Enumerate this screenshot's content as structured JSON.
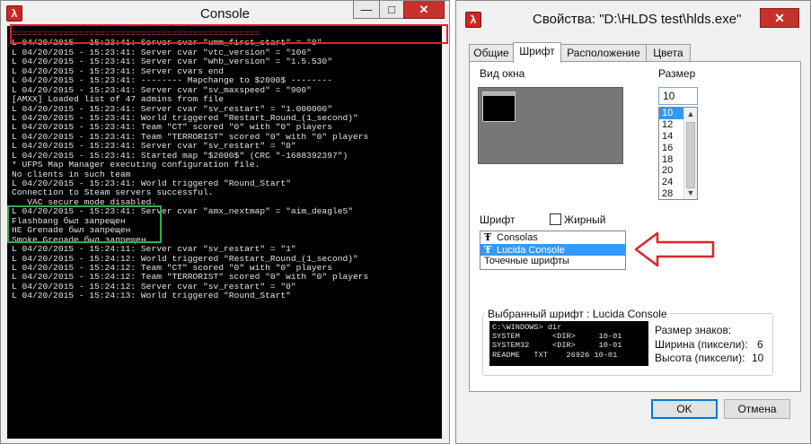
{
  "console": {
    "title": "Console",
    "minimize_glyph": "—",
    "maximize_glyph": "□",
    "close_glyph": "✕",
    "app_icon_glyph": "λ",
    "lines": [
      "================================================",
      "L 04/20/2015 - 15:23:41: Server cvar \"umm_first_start\" = \"0\"",
      "L 04/20/2015 - 15:23:41: Server cvar \"vtc_version\" = \"106\"",
      "L 04/20/2015 - 15:23:41: Server cvar \"whb_version\" = \"1.5.530\"",
      "L 04/20/2015 - 15:23:41: Server cvars end",
      "L 04/20/2015 - 15:23:41: -------- Mapchange to $2000$ --------",
      "L 04/20/2015 - 15:23:41: Server cvar \"sv_maxspeed\" = \"900\"",
      "[AMXX] Loaded list of 47 admins from file",
      "L 04/20/2015 - 15:23:41: Server cvar \"sv_restart\" = \"1.000000\"",
      "L 04/20/2015 - 15:23:41: World triggered \"Restart_Round_(1_second)\"",
      "L 04/20/2015 - 15:23:41: Team \"CT\" scored \"0\" with \"0\" players",
      "L 04/20/2015 - 15:23:41: Team \"TERRORIST\" scored \"0\" with \"0\" players",
      "L 04/20/2015 - 15:23:41: Server cvar \"sv_restart\" = \"0\"",
      "L 04/20/2015 - 15:23:41: Started map \"$2000$\" (CRC \"-1688392397\")",
      "* UFPS Map Manager executing configuration file.",
      "No clients in such team",
      "L 04/20/2015 - 15:23:41: World triggered \"Round_Start\"",
      "Connection to Steam servers successful.",
      "   VAC secure mode disabled.",
      "L 04/20/2015 - 15:23:41: Server cvar \"amx_nextmap\" = \"aim_deagle5\"",
      "Flashbang был запрещен",
      "HE Grenade был запрещен",
      "Smoke Grenade был запрещен",
      "L 04/20/2015 - 15:24:11: Server cvar \"sv_restart\" = \"1\"",
      "L 04/20/2015 - 15:24:12: World triggered \"Restart_Round_(1_second)\"",
      "L 04/20/2015 - 15:24:12: Team \"CT\" scored \"0\" with \"0\" players",
      "L 04/20/2015 - 15:24:12: Team \"TERRORIST\" scored \"0\" with \"0\" players",
      "L 04/20/2015 - 15:24:12: Server cvar \"sv_restart\" = \"0\"",
      "L 04/20/2015 - 15:24:13: World triggered \"Round_Start\""
    ],
    "highlight_colors": {
      "red_box": "#e0202a",
      "green_box": "#2fae4e"
    }
  },
  "dialog": {
    "title": "Свойства: \"D:\\HLDS test\\hlds.exe\"",
    "close_glyph": "✕",
    "tabs": [
      "Общие",
      "Шрифт",
      "Расположение",
      "Цвета"
    ],
    "active_tab": "Шрифт",
    "window_preview_label": "Вид окна",
    "size_label": "Размер",
    "size_value": "10",
    "size_options": [
      "10",
      "12",
      "14",
      "16",
      "18",
      "20",
      "24",
      "28"
    ],
    "font_label": "Шрифт",
    "bold_label": "Жирный",
    "bold_checked": false,
    "fonts": [
      {
        "glyph": "Ŧ",
        "name": "Consolas"
      },
      {
        "glyph": "Ŧ",
        "name": "Lucida Console"
      },
      {
        "glyph": "",
        "name": "Точечные шрифты"
      }
    ],
    "selected_font": "Lucida Console",
    "selected_font_label": "Выбранный шрифт : Lucida Console",
    "sample_lines": [
      "C:\\WINDOWS> dir",
      "SYSTEM       <DIR>     10-01",
      "SYSTEM32     <DIR>     10-01",
      "README   TXT    26926 10-01"
    ],
    "char_size_label": "Размер знаков:",
    "width_label": "Ширина (пиксели):",
    "width_value": "6",
    "height_label": "Высота (пиксели):",
    "height_value": "10",
    "ok_label": "OK",
    "cancel_label": "Отмена",
    "arrow_color": "#d8262a",
    "selection_color": "#3399ff"
  }
}
